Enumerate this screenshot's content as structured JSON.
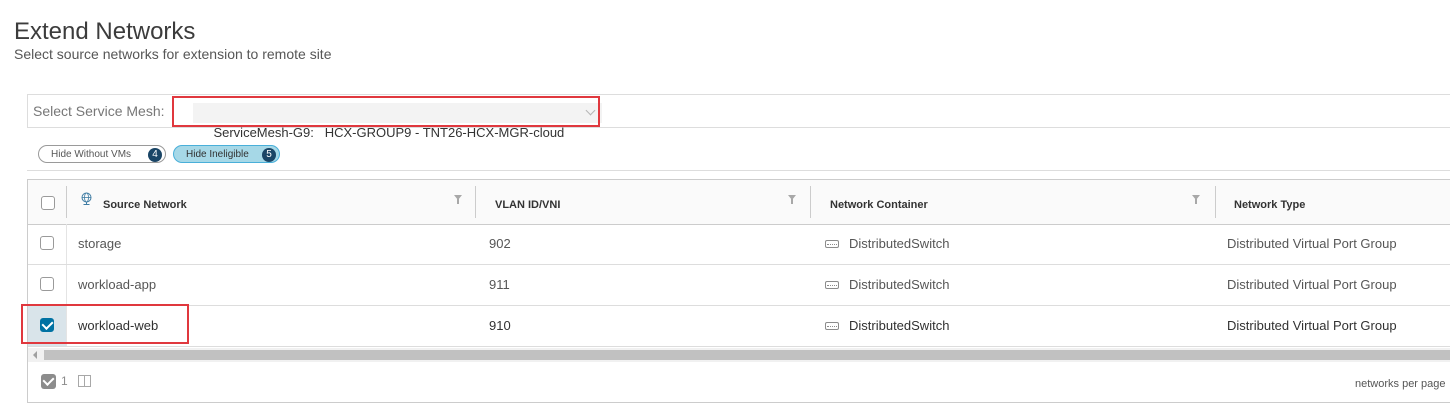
{
  "page": {
    "title": "Extend Networks",
    "subtitle": "Select source networks for extension to remote site"
  },
  "service_mesh": {
    "label": "Select Service Mesh:",
    "selected": "ServiceMesh-G9:   HCX-GROUP9 - TNT26-HCX-MGR-cloud"
  },
  "filters": [
    {
      "label": "Hide Without VMs",
      "count": "4",
      "active": false
    },
    {
      "label": "Hide Ineligible",
      "count": "5",
      "active": true
    }
  ],
  "table": {
    "columns": [
      "Source Network",
      "VLAN ID/VNI",
      "Network Container",
      "Network Type"
    ],
    "rows": [
      {
        "network": "storage",
        "vlan": "902",
        "container": "DistributedSwitch",
        "type": "Distributed Virtual Port Group",
        "checked": false
      },
      {
        "network": "workload-app",
        "vlan": "911",
        "container": "DistributedSwitch",
        "type": "Distributed Virtual Port Group",
        "checked": false
      },
      {
        "network": "workload-web",
        "vlan": "910",
        "container": "DistributedSwitch",
        "type": "Distributed Virtual Port Group",
        "checked": true
      }
    ],
    "footer": {
      "selected_count": "1",
      "per_page_label": "networks per page"
    }
  },
  "colors": {
    "accent": "#0072a3",
    "highlight": "#e0383e",
    "chip_active": "#a6d8e7",
    "badge": "#1a4566"
  }
}
